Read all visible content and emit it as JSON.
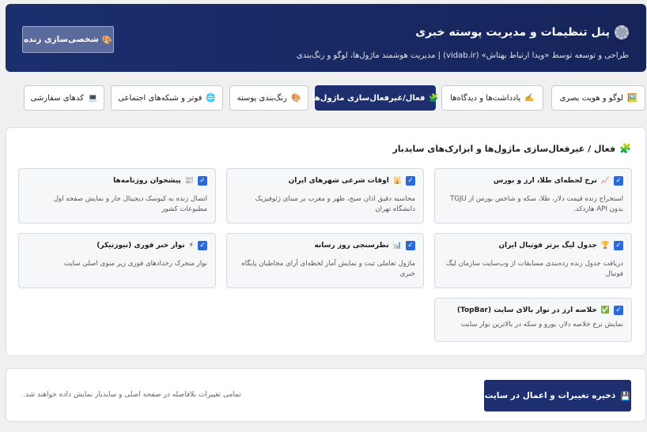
{
  "header": {
    "title": "پنل تنظیمات و مدیریت پوسته خبری",
    "subtitle": "طراحی و توسعه توسط «ویدا ارتباط بهتاش» (vidab.ir) | مدیریت هوشمند ماژول‌ها، لوگو و رنگ‌بندی",
    "live_button": "شخصی‌سازی زنده",
    "live_icon": "🎨"
  },
  "tabs": [
    {
      "label": "لوگو و هویت بصری",
      "icon": "🖼️"
    },
    {
      "label": "یادداشت‌ها و دیدگاه‌ها",
      "icon": "✍️"
    },
    {
      "label": "فعال/غیرفعال‌سازی ماژول‌ها",
      "icon": "🧩"
    },
    {
      "label": "رنگ‌بندی پوسته",
      "icon": "🎨"
    },
    {
      "label": "فوتر و شبکه‌های اجتماعی",
      "icon": "🌐"
    },
    {
      "label": "کدهای سفارشی",
      "icon": "💻"
    }
  ],
  "active_tab": 2,
  "panel": {
    "title": "فعال / غیرفعال‌سازی ماژول‌ها و ابزارک‌های سایدبار",
    "icon": "🧩"
  },
  "modules": [
    {
      "icon": "📈",
      "title": "نرخ لحظه‌ای طلا، ارز و بورس",
      "desc": "استخراج زنده قیمت دلار، طلا، سکه و شاخص بورس از TGJU بدون API هاردکد.",
      "checked": true
    },
    {
      "icon": "🕌",
      "title": "اوقات شرعی شهرهای ایران",
      "desc": "محاسبه دقیق اذان صبح، ظهر و مغرب بر مبنای ژئوفیزیک دانشگاه تهران",
      "checked": true
    },
    {
      "icon": "📰",
      "title": "پیشخوان روزنامه‌ها",
      "desc": "اتصال زنده به کیوسک دیجیتال جار و نمایش صفحه اول مطبوعات کشور",
      "checked": true
    },
    {
      "icon": "🏆",
      "title": "جدول لیگ برتر فوتبال ایران",
      "desc": "دریافت جدول زنده رده‌بندی مسابقات از وب‌سایت سازمان لیگ فوتبال",
      "checked": true
    },
    {
      "icon": "📊",
      "title": "نظرسنجی روز رسانه",
      "desc": "ماژول تعاملی ثبت و نمایش آمار لحظه‌ای آرای مخاطبان پایگاه خبری",
      "checked": true
    },
    {
      "icon": "⚡",
      "title": "نوار خبر فوری (نیوزتیکر)",
      "desc": "نوار متحرک رخدادهای فوری زیر منوی اصلی سایت",
      "checked": true
    },
    {
      "icon": "✅",
      "title": "خلاصه ارز در نوار بالای سایت (TopBar)",
      "desc": "نمایش نرخ خلاصه دلار، یورو و سکه در بالاترین نوار سایت",
      "checked": true
    }
  ],
  "footer": {
    "save_label": "ذخیره تغییرات و اعمال در سایت",
    "save_icon": "💾",
    "note": "تمامی تغییرات بلافاصله در صفحه اصلی و سایدبار نمایش داده خواهند شد."
  },
  "colors": {
    "accent": "#1d2f6f",
    "checkbox": "#2c6ad8"
  }
}
